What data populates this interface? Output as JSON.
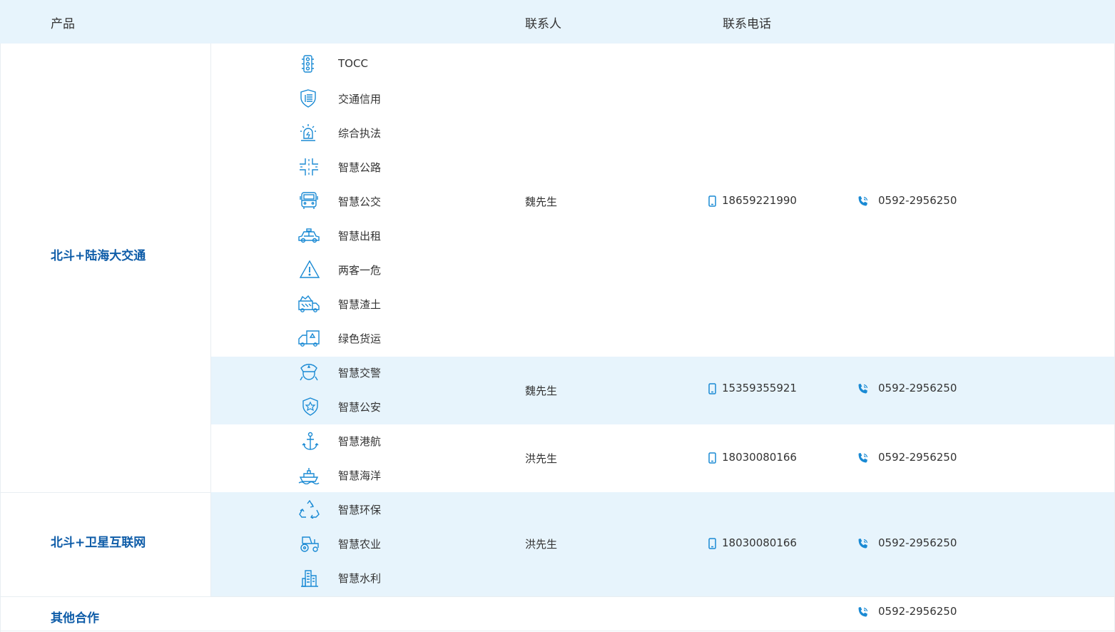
{
  "header": {
    "product": "产品",
    "contact": "联系人",
    "phone": "联系电话"
  },
  "categories": [
    {
      "label": "北斗+陆海大交通"
    },
    {
      "label": "北斗+卫星互联网"
    },
    {
      "label": "其他合作"
    }
  ],
  "products": [
    {
      "label": "TOCC",
      "icon": "traffic-light-icon"
    },
    {
      "label": "交通信用",
      "icon": "credit-shield-icon"
    },
    {
      "label": "综合执法",
      "icon": "alarm-siren-icon"
    },
    {
      "label": "智慧公路",
      "icon": "road-junction-icon"
    },
    {
      "label": "智慧公交",
      "icon": "bus-icon"
    },
    {
      "label": "智慧出租",
      "icon": "taxi-icon"
    },
    {
      "label": "两客一危",
      "icon": "warning-triangle-icon"
    },
    {
      "label": "智慧渣土",
      "icon": "dump-truck-icon"
    },
    {
      "label": "绿色货运",
      "icon": "freight-truck-icon"
    },
    {
      "label": "智慧交警",
      "icon": "police-cap-icon"
    },
    {
      "label": "智慧公安",
      "icon": "police-badge-icon"
    },
    {
      "label": "智慧港航",
      "icon": "anchor-icon"
    },
    {
      "label": "智慧海洋",
      "icon": "ship-icon"
    },
    {
      "label": "智慧环保",
      "icon": "recycle-icon"
    },
    {
      "label": "智慧农业",
      "icon": "tractor-icon"
    },
    {
      "label": "智慧水利",
      "icon": "water-building-icon"
    }
  ],
  "groups": [
    {
      "contact": "魏先生",
      "mobile": "18659221990",
      "phone": "0592-2956250"
    },
    {
      "contact": "魏先生",
      "mobile": "15359355921",
      "phone": "0592-2956250"
    },
    {
      "contact": "洪先生",
      "mobile": "18030080166",
      "phone": "0592-2956250"
    },
    {
      "contact": "洪先生",
      "mobile": "18030080166",
      "phone": "0592-2956250"
    },
    {
      "contact": "",
      "mobile": "",
      "phone": "0592-2956250"
    }
  ],
  "colors": {
    "accent": "#0e5ca8",
    "icon": "#1a8ad4",
    "band": "#e7f4fc"
  }
}
